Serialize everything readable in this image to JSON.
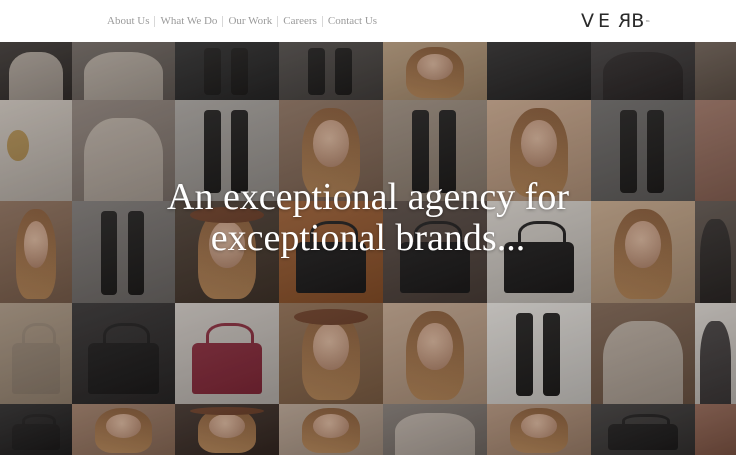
{
  "nav": {
    "items": [
      {
        "label": "About Us"
      },
      {
        "label": "What We Do"
      },
      {
        "label": "Our Work"
      },
      {
        "label": "Careers"
      },
      {
        "label": "Contact Us"
      }
    ]
  },
  "brand": {
    "logo_text": "VERB",
    "logo_mark": "™"
  },
  "hero": {
    "line1": "An exceptional agency for",
    "line2": "exceptional brands..."
  },
  "colors": {
    "nav_text": "#9a9a9a",
    "logo": "#2a2a2a",
    "headline": "#ffffff"
  },
  "mosaic": {
    "tiles": [
      {
        "subject": "fur-coat-icon",
        "bg": "#3a3431"
      },
      {
        "subject": "fur-coat-icon",
        "bg": "#6f6660"
      },
      {
        "subject": "legs-icon",
        "bg": "#2c2b2b"
      },
      {
        "subject": "boots-icon",
        "bg": "#4d4845"
      },
      {
        "subject": "portrait-icon",
        "bg": "#b79a7a"
      },
      {
        "subject": "pattern-icon",
        "bg": "#2a2828"
      },
      {
        "subject": "jacket-icon",
        "bg": "#3d3939"
      },
      {
        "subject": "street-icon",
        "bg": "#6a5b50"
      },
      {
        "subject": "watch-icon",
        "bg": "#cfc6bd"
      },
      {
        "subject": "fur-coat-icon",
        "bg": "#8d8078"
      },
      {
        "subject": "boots-icon",
        "bg": "#a8a39e"
      },
      {
        "subject": "portrait-icon",
        "bg": "#8b6f5c"
      },
      {
        "subject": "boots-icon",
        "bg": "#9c8c7d"
      },
      {
        "subject": "portrait-icon",
        "bg": "#c9a68a"
      },
      {
        "subject": "boots-icon",
        "bg": "#6a6765"
      },
      {
        "subject": "street-icon",
        "bg": "#9b7060"
      },
      {
        "subject": "portrait-icon",
        "bg": "#8a6b56"
      },
      {
        "subject": "boots-icon",
        "bg": "#7b7673"
      },
      {
        "subject": "hat-icon",
        "bg": "#4a3b30"
      },
      {
        "subject": "bag-icon",
        "bg": "#9a5a2e"
      },
      {
        "subject": "bag-icon",
        "bg": "#54463f"
      },
      {
        "subject": "bag-icon",
        "bg": "#d9d3cc"
      },
      {
        "subject": "portrait-icon",
        "bg": "#c4a587"
      },
      {
        "subject": "jacket-icon",
        "bg": "#5a4f48"
      },
      {
        "subject": "studded-bag-icon",
        "bg": "#a99580"
      },
      {
        "subject": "bag-icon",
        "bg": "#2f2c2c"
      },
      {
        "subject": "quilted-bag-icon",
        "bg": "#cfc8c2"
      },
      {
        "subject": "hat-icon",
        "bg": "#8d6a4d"
      },
      {
        "subject": "portrait-icon",
        "bg": "#c2a48b"
      },
      {
        "subject": "boots-icon",
        "bg": "#e5e1dc"
      },
      {
        "subject": "fur-coat-icon",
        "bg": "#7a5f4c"
      },
      {
        "subject": "jacket-icon",
        "bg": "#d8d2cc"
      },
      {
        "subject": "bag-icon",
        "bg": "#262424"
      },
      {
        "subject": "portrait-icon",
        "bg": "#9b7862"
      },
      {
        "subject": "hat-icon",
        "bg": "#3b2c25"
      },
      {
        "subject": "portrait-icon",
        "bg": "#b6a08e"
      },
      {
        "subject": "fur-coat-icon",
        "bg": "#7f7670"
      },
      {
        "subject": "portrait-icon",
        "bg": "#b08f77"
      },
      {
        "subject": "bag-icon",
        "bg": "#3a3736"
      },
      {
        "subject": "street-icon",
        "bg": "#8c5e4c"
      }
    ]
  }
}
